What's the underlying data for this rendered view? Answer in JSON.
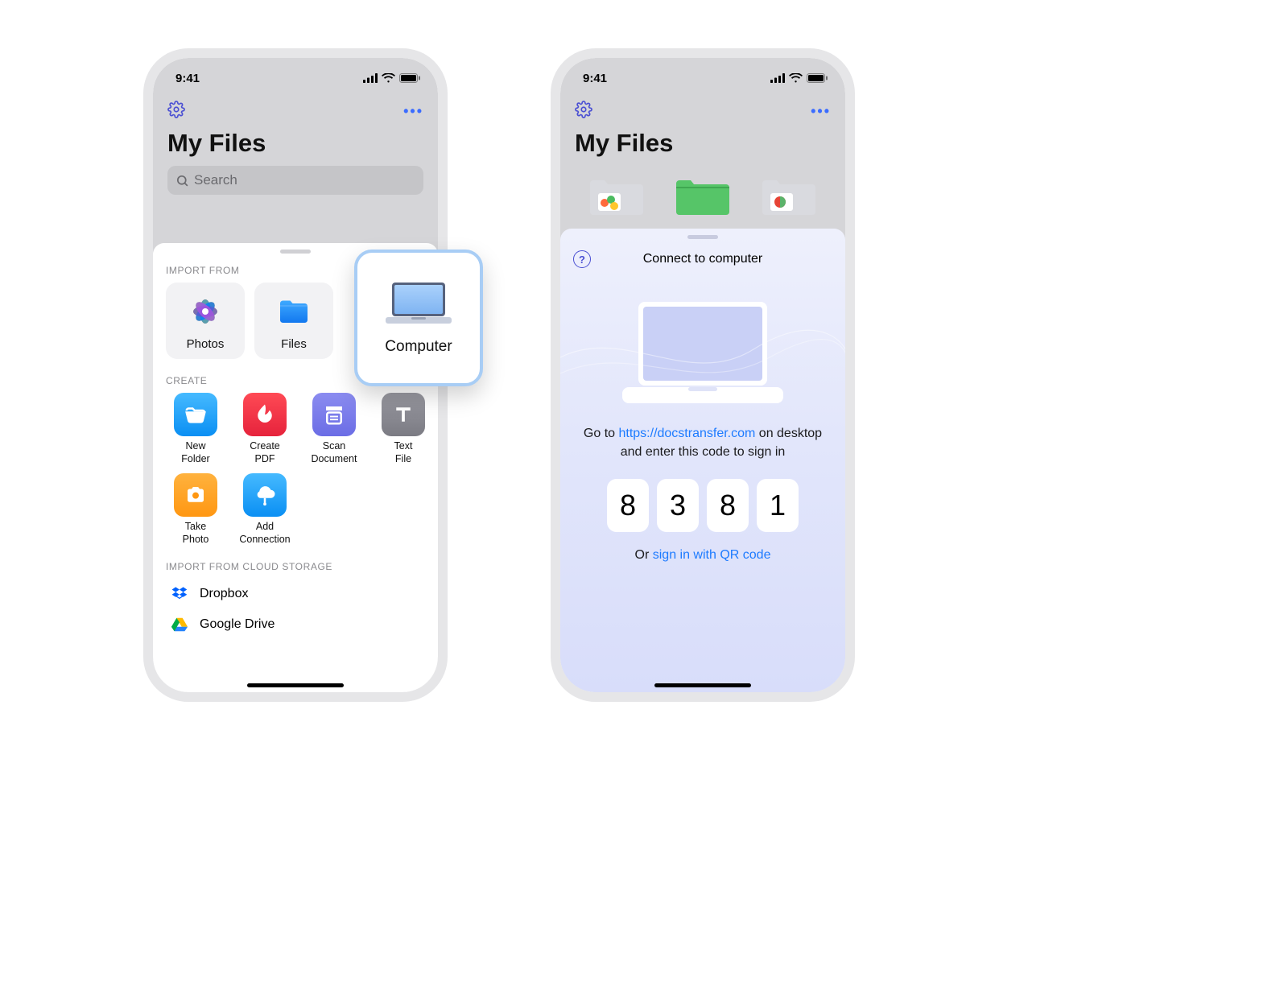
{
  "status": {
    "time": "9:41"
  },
  "left": {
    "page_title": "My Files",
    "search_placeholder": "Search",
    "import_from_label": "IMPORT FROM",
    "tiles": {
      "photos": "Photos",
      "files": "Files",
      "computer": "Computer"
    },
    "create_label": "CREATE",
    "create_items": {
      "new_folder": "New\nFolder",
      "create_pdf": "Create\nPDF",
      "scan_doc": "Scan\nDocument",
      "text_file": "Text\nFile",
      "take_photo": "Take\nPhoto",
      "add_connection": "Add\nConnection"
    },
    "cloud_label": "IMPORT FROM CLOUD STORAGE",
    "cloud": {
      "dropbox": "Dropbox",
      "google_drive": "Google Drive"
    }
  },
  "right": {
    "page_title": "My Files",
    "connect_title": "Connect to computer",
    "instruction_prefix": "Go to ",
    "instruction_url": "https://docstransfer.com",
    "instruction_suffix": " on desktop and enter this code to sign in",
    "code": [
      "8",
      "3",
      "8",
      "1"
    ],
    "qr_prefix": "Or ",
    "qr_link": "sign in with QR code"
  }
}
